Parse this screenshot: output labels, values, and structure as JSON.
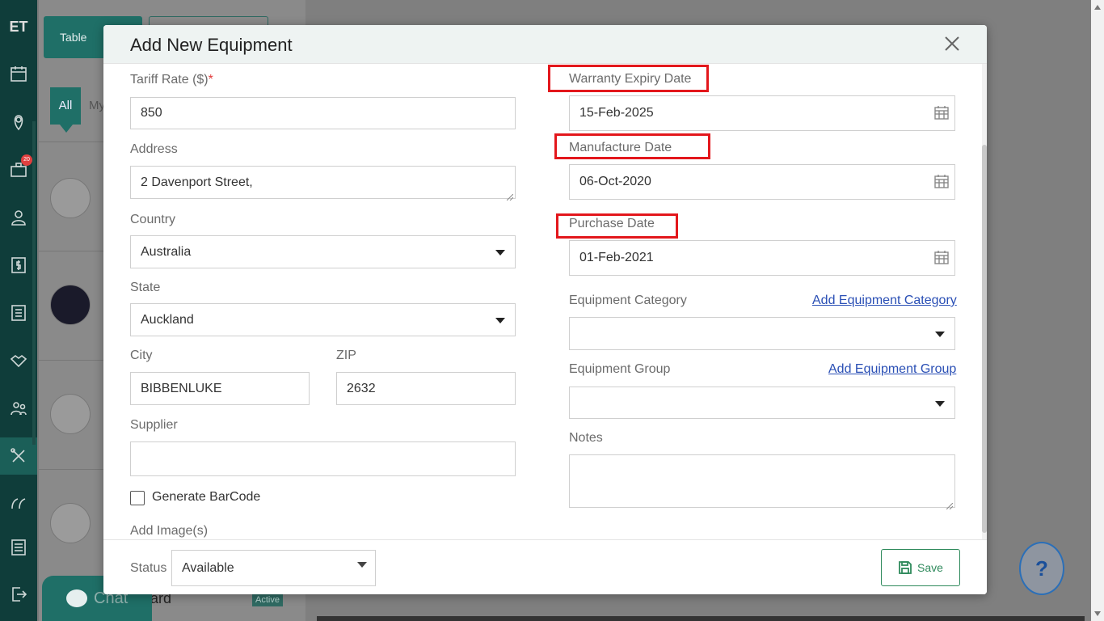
{
  "app": {
    "logo": "ET"
  },
  "nav": {
    "badge_count": "20"
  },
  "background": {
    "table_button": "Table",
    "tab_all": "All",
    "tab_my": "My",
    "row_text": "ard",
    "row_status": "Active"
  },
  "chat": {
    "label": "Chat"
  },
  "help": {
    "label": "?"
  },
  "modal": {
    "title": "Add New Equipment",
    "left": {
      "tariff_label": "Tariff Rate ($)",
      "tariff_required": "*",
      "tariff_value": "850",
      "address_label": "Address",
      "address_value": "2 Davenport Street,",
      "country_label": "Country",
      "country_value": "Australia",
      "state_label": "State",
      "state_value": "Auckland",
      "city_label": "City",
      "city_value": "BIBBENLUKE",
      "zip_label": "ZIP",
      "zip_value": "2632",
      "supplier_label": "Supplier",
      "supplier_value": "",
      "barcode_label": "Generate BarCode",
      "add_image_label": "Add Image(s)"
    },
    "right": {
      "warranty_label": "Warranty Expiry Date",
      "warranty_value": "15-Feb-2025",
      "manufacture_label": "Manufacture Date",
      "manufacture_value": "06-Oct-2020",
      "purchase_label": "Purchase Date",
      "purchase_value": "01-Feb-2021",
      "category_label": "Equipment Category",
      "category_link": "Add Equipment Category",
      "category_value": "",
      "group_label": "Equipment Group",
      "group_link": "Add Equipment Group",
      "group_value": "",
      "notes_label": "Notes",
      "notes_value": ""
    },
    "footer": {
      "status_label": "Status",
      "status_value": "Available",
      "save_label": "Save"
    }
  },
  "colors": {
    "accent": "#1f6f67",
    "highlight_box": "#e3171c",
    "link": "#2a4fb5",
    "save": "#2f8a5c"
  }
}
